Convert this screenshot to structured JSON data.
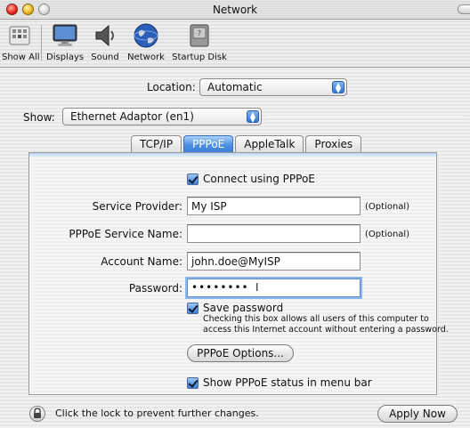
{
  "window": {
    "title": "Network"
  },
  "toolbar": {
    "items": [
      {
        "label": "Show All",
        "icon": "apple-grid-icon"
      },
      {
        "label": "Displays",
        "icon": "display-icon"
      },
      {
        "label": "Sound",
        "icon": "speaker-icon"
      },
      {
        "label": "Network",
        "icon": "globe-icon"
      },
      {
        "label": "Startup Disk",
        "icon": "disk-icon"
      }
    ]
  },
  "location": {
    "label": "Location:",
    "value": "Automatic"
  },
  "show": {
    "label": "Show:",
    "value": "Ethernet Adaptor (en1)"
  },
  "tabs": [
    {
      "label": "TCP/IP",
      "active": false
    },
    {
      "label": "PPPoE",
      "active": true
    },
    {
      "label": "AppleTalk",
      "active": false
    },
    {
      "label": "Proxies",
      "active": false
    }
  ],
  "pppoe": {
    "connect_label": "Connect using PPPoE",
    "connect_checked": true,
    "service_provider": {
      "label": "Service Provider:",
      "value": "My ISP",
      "hint": "(Optional)"
    },
    "service_name": {
      "label": "PPPoE Service Name:",
      "value": "",
      "hint": "(Optional)"
    },
    "account_name": {
      "label": "Account Name:",
      "value": "john.doe@MyISP"
    },
    "password": {
      "label": "Password:",
      "value": "••••••••"
    },
    "save_password_label": "Save password",
    "save_password_checked": true,
    "save_password_note": "Checking this box allows all users of this computer to access this Internet account without entering a password.",
    "options_button": "PPPoE Options...",
    "status_label": "Show PPPoE status in menu bar",
    "status_checked": true
  },
  "footer": {
    "lock_text": "Click the lock to prevent further changes.",
    "apply_button": "Apply Now"
  },
  "colors": {
    "accent": "#3d7fd6",
    "tab_active_text": "#ffffff"
  }
}
